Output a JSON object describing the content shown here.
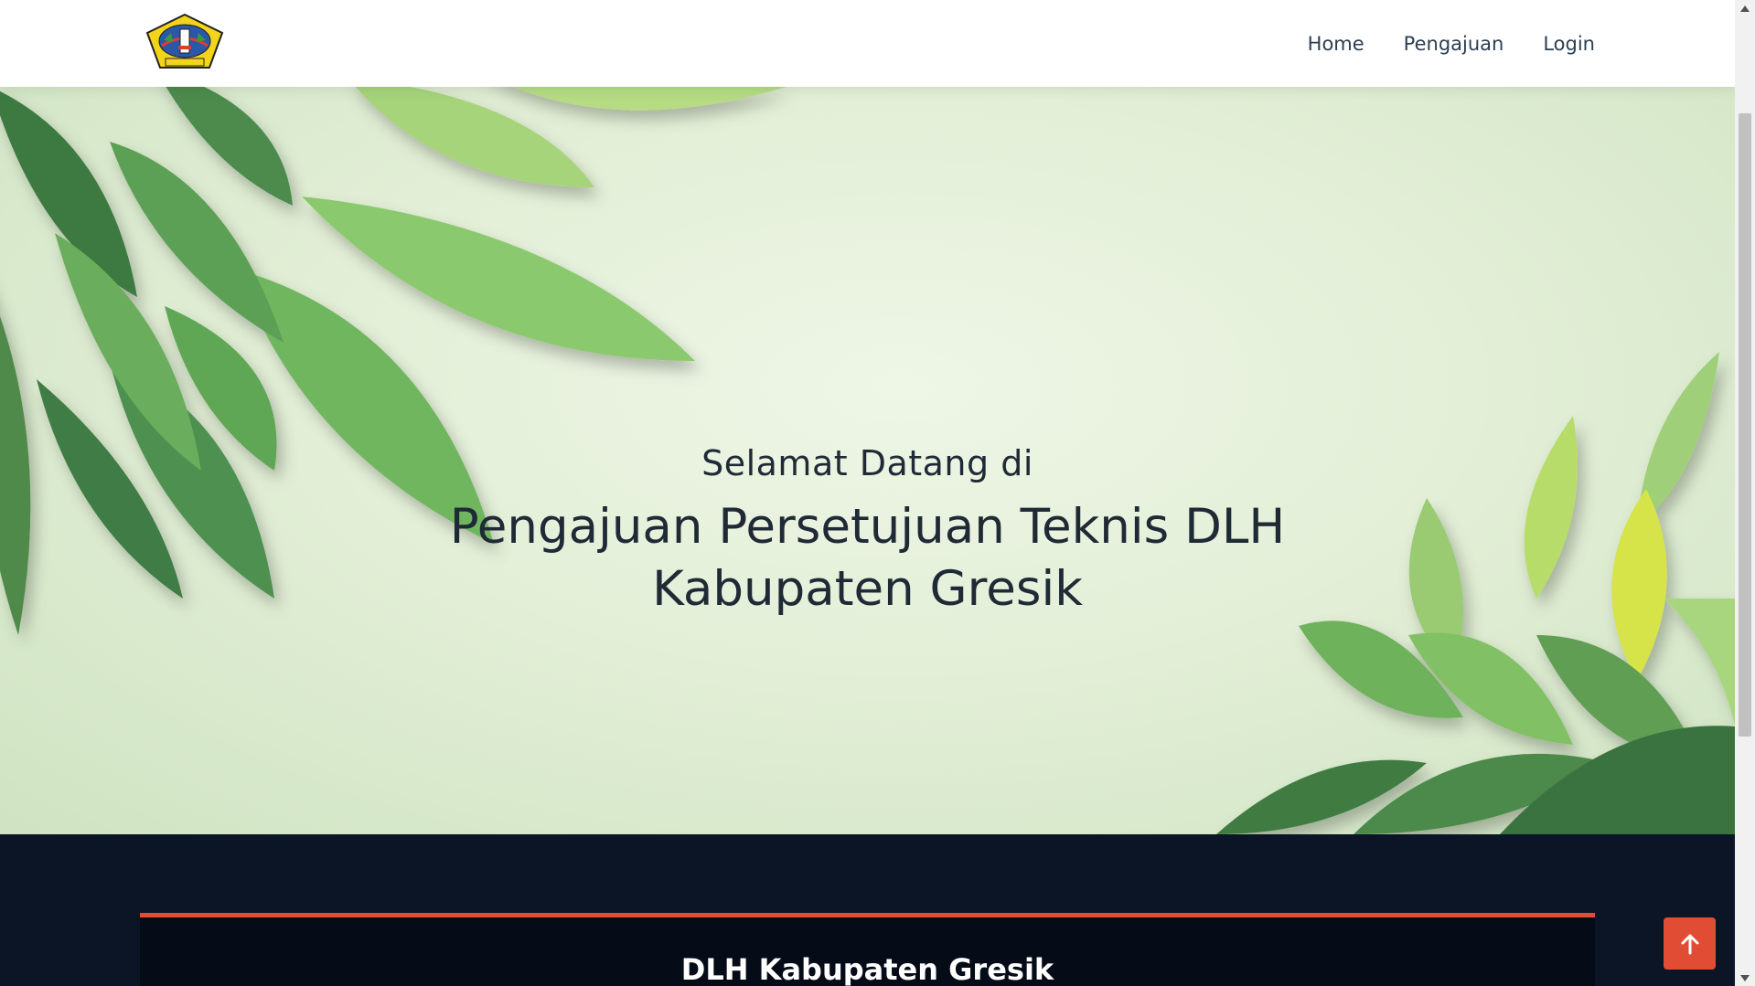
{
  "nav": {
    "items": [
      {
        "label": "Home"
      },
      {
        "label": "Pengajuan"
      },
      {
        "label": "Login"
      }
    ]
  },
  "hero": {
    "subtitle": "Selamat Datang di",
    "title_line1": "Pengajuan Persetujuan Teknis DLH",
    "title_line2": "Kabupaten Gresik"
  },
  "section": {
    "title": "DLH Kabupaten Gresik"
  },
  "logo": {
    "text": "GRESIK"
  },
  "icons": {
    "to_top": "arrow-up-icon"
  },
  "colors": {
    "accent": "#e14d34",
    "dark_bg": "#0b1526",
    "header_bg": "#ffffff"
  }
}
